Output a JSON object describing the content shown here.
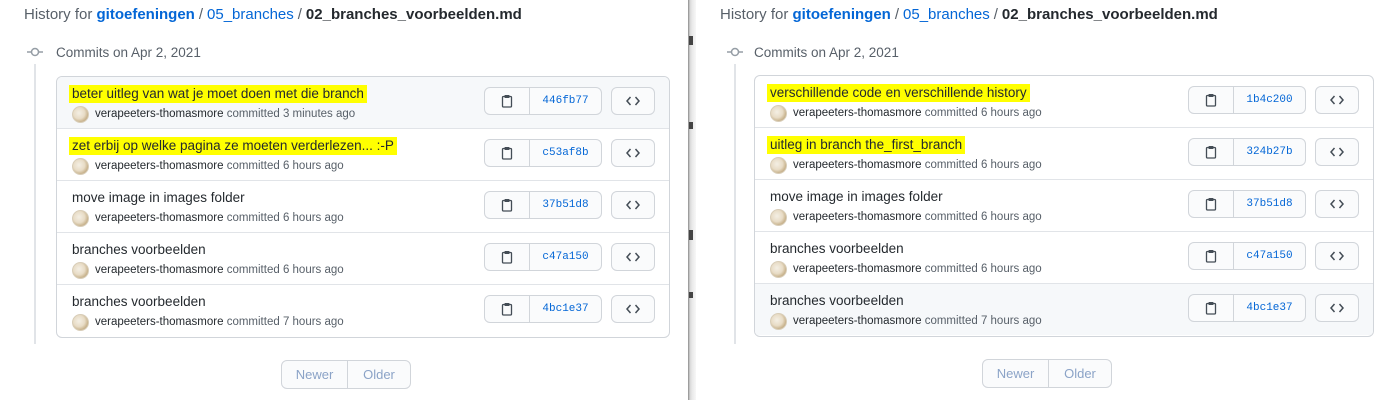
{
  "panes": [
    {
      "breadcrumb": {
        "prefix": "History for",
        "repo": "gitoefeningen",
        "folder": "05_branches",
        "separator": "/",
        "file": "02_branches_voorbeelden.md"
      },
      "date_header": "Commits on Apr 2, 2021",
      "commits": [
        {
          "title": "beter uitleg van wat je moet doen met die branch",
          "author": "verapeeters-thomasmore",
          "action": "committed",
          "time": "3 minutes ago",
          "sha": "446fb77",
          "highlighted": true
        },
        {
          "title": "zet erbij op welke pagina ze moeten verderlezen... :-P",
          "author": "verapeeters-thomasmore",
          "action": "committed",
          "time": "6 hours ago",
          "sha": "c53af8b",
          "highlighted": true
        },
        {
          "title": "move image in images folder",
          "author": "verapeeters-thomasmore",
          "action": "committed",
          "time": "6 hours ago",
          "sha": "37b51d8",
          "highlighted": false
        },
        {
          "title": "branches voorbeelden",
          "author": "verapeeters-thomasmore",
          "action": "committed",
          "time": "6 hours ago",
          "sha": "c47a150",
          "highlighted": false
        },
        {
          "title": "branches voorbeelden",
          "author": "verapeeters-thomasmore",
          "action": "committed",
          "time": "7 hours ago",
          "sha": "4bc1e37",
          "highlighted": false
        }
      ],
      "pagination": {
        "newer": "Newer",
        "older": "Older"
      }
    },
    {
      "breadcrumb": {
        "prefix": "History for",
        "repo": "gitoefeningen",
        "folder": "05_branches",
        "separator": "/",
        "file": "02_branches_voorbeelden.md"
      },
      "date_header": "Commits on Apr 2, 2021",
      "commits": [
        {
          "title": "verschillende code en verschillende history",
          "author": "verapeeters-thomasmore",
          "action": "committed",
          "time": "6 hours ago",
          "sha": "1b4c200",
          "highlighted": true
        },
        {
          "title": "uitleg in branch the_first_branch",
          "author": "verapeeters-thomasmore",
          "action": "committed",
          "time": "6 hours ago",
          "sha": "324b27b",
          "highlighted": true
        },
        {
          "title": "move image in images folder",
          "author": "verapeeters-thomasmore",
          "action": "committed",
          "time": "6 hours ago",
          "sha": "37b51d8",
          "highlighted": false
        },
        {
          "title": "branches voorbeelden",
          "author": "verapeeters-thomasmore",
          "action": "committed",
          "time": "6 hours ago",
          "sha": "c47a150",
          "highlighted": false
        },
        {
          "title": "branches voorbeelden",
          "author": "verapeeters-thomasmore",
          "action": "committed",
          "time": "7 hours ago",
          "sha": "4bc1e37",
          "highlighted": false
        }
      ],
      "pagination": {
        "newer": "Newer",
        "older": "Older"
      }
    }
  ],
  "colors": {
    "highlight": "#ffff00",
    "link": "#0366d6",
    "muted": "#586069"
  },
  "icons": {
    "copy": "clipboard-icon",
    "browse": "code-icon",
    "timeline": "git-commit-icon"
  }
}
